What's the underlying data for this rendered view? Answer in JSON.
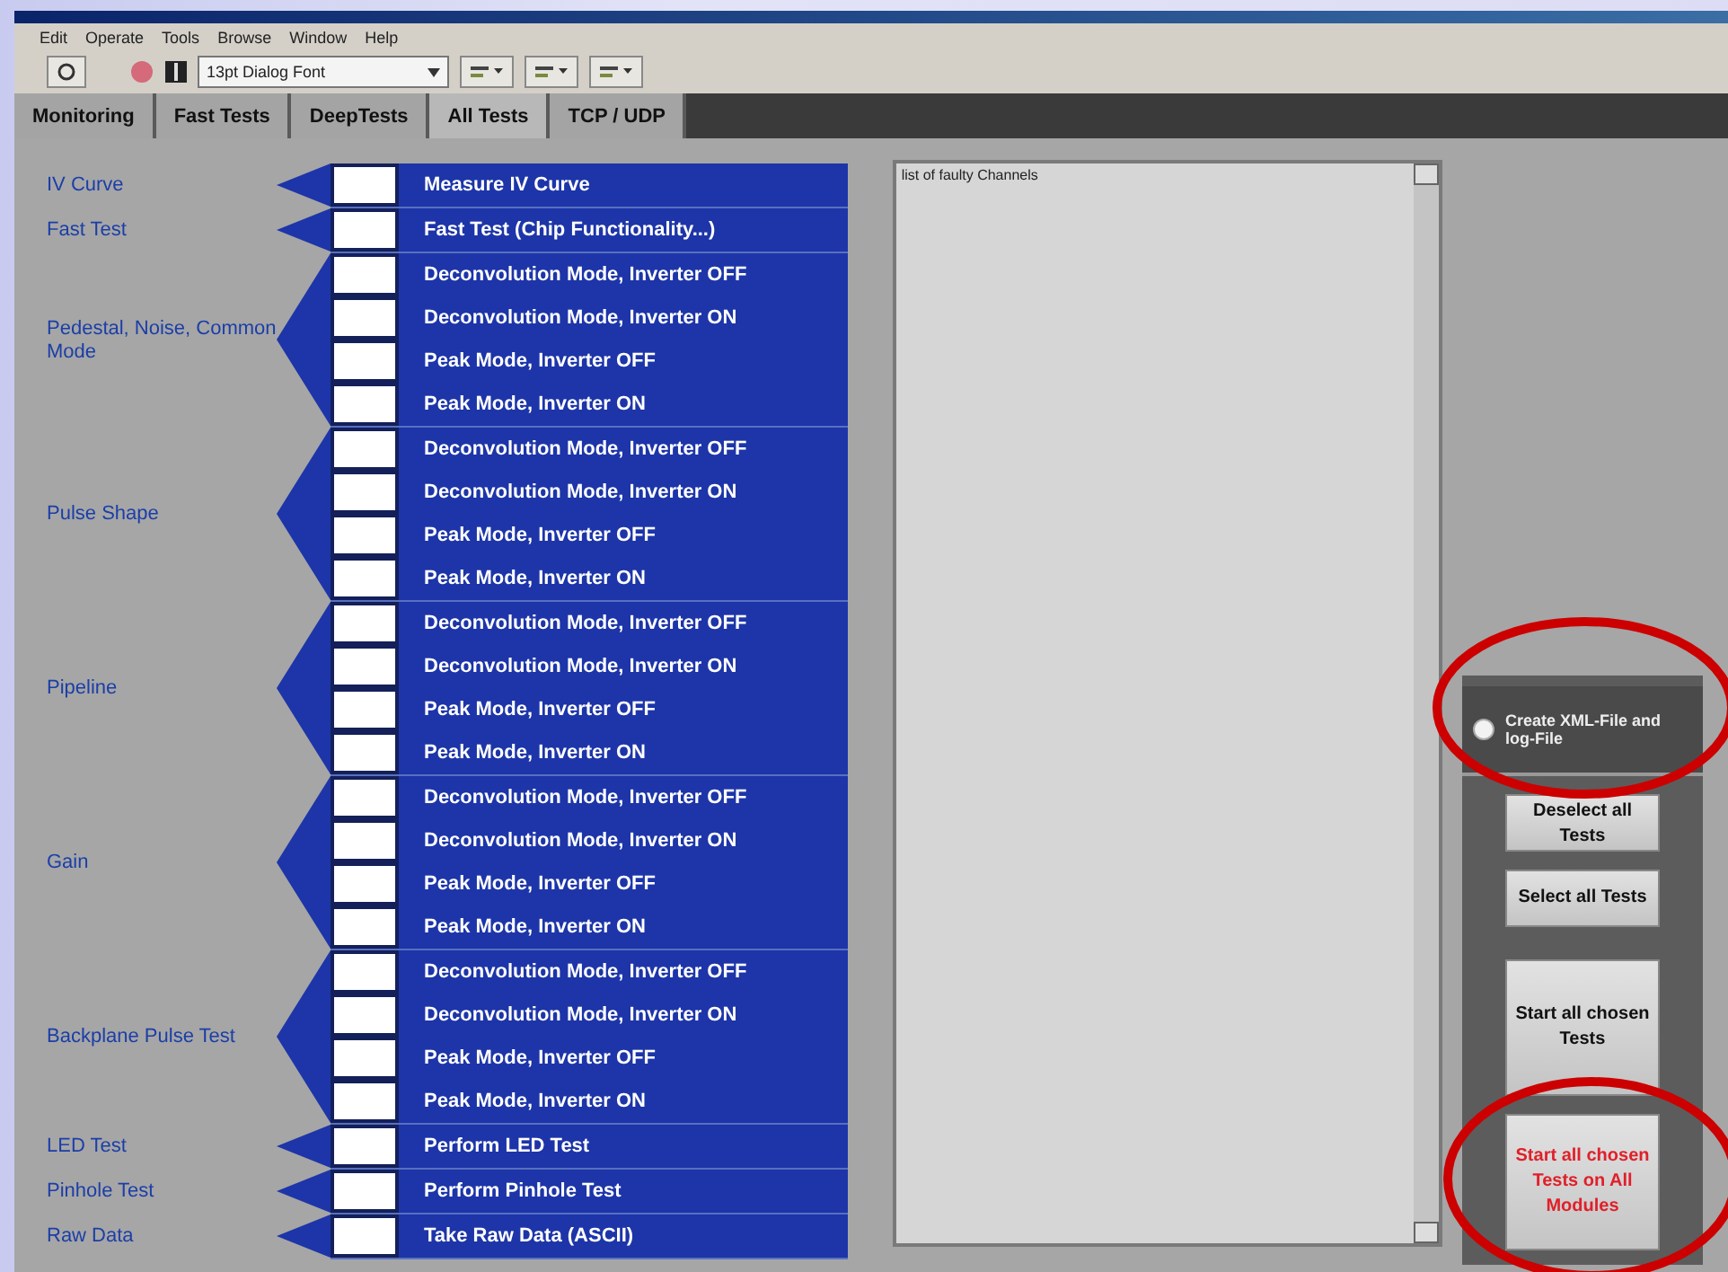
{
  "menu": [
    "Edit",
    "Operate",
    "Tools",
    "Browse",
    "Window",
    "Help"
  ],
  "toolbar": {
    "font": "13pt Dialog Font"
  },
  "tabs": [
    {
      "label": "Monitoring",
      "selected": false
    },
    {
      "label": "Fast Tests",
      "selected": false
    },
    {
      "label": "DeepTests",
      "selected": false
    },
    {
      "label": "All Tests",
      "selected": true
    },
    {
      "label": "TCP / UDP",
      "selected": false
    }
  ],
  "groups": [
    {
      "label": "IV Curve",
      "tests": [
        {
          "label": "Measure IV Curve",
          "checked": false
        }
      ]
    },
    {
      "label": "Fast Test",
      "tests": [
        {
          "label": "Fast Test (Chip Functionality...)",
          "checked": false
        }
      ]
    },
    {
      "label": "Pedestal, Noise, Common Mode",
      "tests": [
        {
          "label": "Deconvolution Mode, Inverter OFF",
          "checked": false
        },
        {
          "label": "Deconvolution Mode, Inverter ON",
          "checked": false
        },
        {
          "label": "Peak Mode, Inverter OFF",
          "checked": false
        },
        {
          "label": "Peak Mode, Inverter ON",
          "checked": false
        }
      ]
    },
    {
      "label": "Pulse Shape",
      "tests": [
        {
          "label": "Deconvolution Mode, Inverter OFF",
          "checked": false
        },
        {
          "label": "Deconvolution Mode, Inverter ON",
          "checked": false
        },
        {
          "label": "Peak Mode, Inverter OFF",
          "checked": false
        },
        {
          "label": "Peak Mode, Inverter ON",
          "checked": false
        }
      ]
    },
    {
      "label": "Pipeline",
      "tests": [
        {
          "label": "Deconvolution Mode, Inverter OFF",
          "checked": false
        },
        {
          "label": "Deconvolution Mode, Inverter ON",
          "checked": false
        },
        {
          "label": "Peak Mode, Inverter OFF",
          "checked": false
        },
        {
          "label": "Peak Mode, Inverter ON",
          "checked": false
        }
      ]
    },
    {
      "label": "Gain",
      "tests": [
        {
          "label": "Deconvolution Mode, Inverter OFF",
          "checked": false
        },
        {
          "label": "Deconvolution Mode, Inverter ON",
          "checked": false
        },
        {
          "label": "Peak Mode, Inverter OFF",
          "checked": false
        },
        {
          "label": "Peak Mode, Inverter ON",
          "checked": false
        }
      ]
    },
    {
      "label": "Backplane Pulse Test",
      "tests": [
        {
          "label": "Deconvolution Mode, Inverter OFF",
          "checked": false
        },
        {
          "label": "Deconvolution Mode, Inverter ON",
          "checked": false
        },
        {
          "label": "Peak Mode, Inverter OFF",
          "checked": false
        },
        {
          "label": "Peak Mode, Inverter ON",
          "checked": false
        }
      ]
    },
    {
      "label": "LED Test",
      "tests": [
        {
          "label": "Perform LED Test",
          "checked": false
        }
      ]
    },
    {
      "label": "Pinhole Test",
      "tests": [
        {
          "label": "Perform Pinhole Test",
          "checked": false
        }
      ]
    },
    {
      "label": "Raw Data",
      "tests": [
        {
          "label": "Take Raw Data (ASCII)",
          "checked": false
        }
      ]
    }
  ],
  "faulty_list": {
    "title": "list of faulty Channels"
  },
  "xml_toggle": {
    "label": "Create XML-File and log-File",
    "on": true
  },
  "buttons": [
    {
      "label": "Deselect all Tests",
      "kind": "small"
    },
    {
      "label": "Select all Tests",
      "kind": "small"
    },
    {
      "label": "Start all chosen Tests",
      "kind": "large"
    },
    {
      "label": "Start all chosen Tests on All Modules",
      "kind": "alert"
    }
  ]
}
